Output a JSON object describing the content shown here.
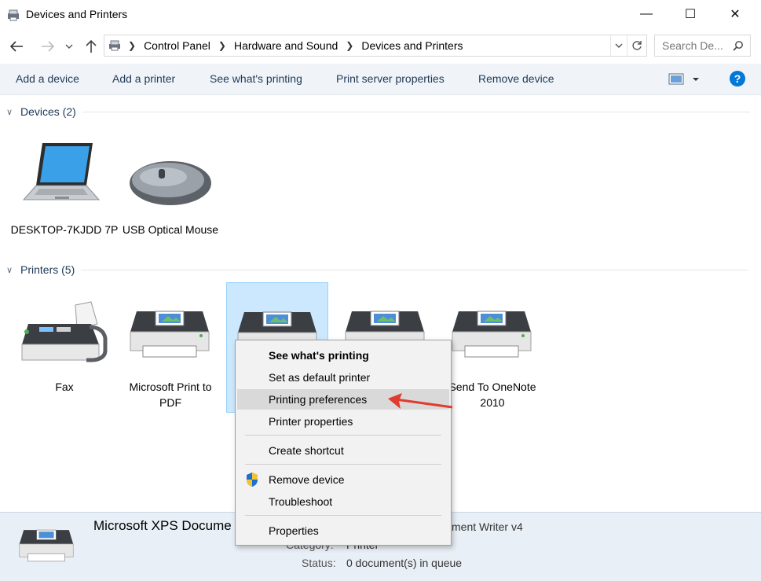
{
  "window": {
    "title": "Devices and Printers",
    "controls": {
      "minimize": "—",
      "maximize": "☐",
      "close": "✕"
    }
  },
  "address": {
    "breadcrumbs": [
      "Control Panel",
      "Hardware and Sound",
      "Devices and Printers"
    ],
    "search_placeholder": "Search De..."
  },
  "toolbar": {
    "add_device": "Add a device",
    "add_printer": "Add a printer",
    "see_printing": "See what's printing",
    "server_props": "Print server properties",
    "remove_device": "Remove device"
  },
  "groups": {
    "devices": {
      "header": "Devices (2)",
      "items": [
        {
          "label": "DESKTOP-7KJDD 7P",
          "icon": "laptop-icon"
        },
        {
          "label": "USB Optical Mouse",
          "icon": "mouse-icon"
        }
      ]
    },
    "printers": {
      "header": "Printers (5)",
      "items": [
        {
          "label": "Fax",
          "icon": "fax-icon"
        },
        {
          "label": "Microsoft Print to PDF",
          "icon": "printer-icon"
        },
        {
          "label": "",
          "icon": "printer-icon",
          "selected": true
        },
        {
          "label": "",
          "icon": "printer-icon"
        },
        {
          "label": "Send To OneNote 2010",
          "icon": "printer-icon"
        }
      ]
    }
  },
  "context_menu": {
    "items": [
      "See what's printing",
      "Set as default printer",
      "Printing preferences",
      "Printer properties",
      "Create shortcut",
      "Remove device",
      "Troubleshoot",
      "Properties"
    ],
    "highlighted": "Printing preferences"
  },
  "details": {
    "name": "Microsoft XPS Docume",
    "model_partial": "ment Writer v4",
    "category_label": "Category:",
    "category_value": "Printer",
    "status_label": "Status:",
    "status_value": "0 document(s) in queue"
  },
  "colors": {
    "accent": "#0078d7",
    "selection": "#cce8ff",
    "cmdbar": "#f0f4f9",
    "annotation_arrow": "#e03c31"
  }
}
